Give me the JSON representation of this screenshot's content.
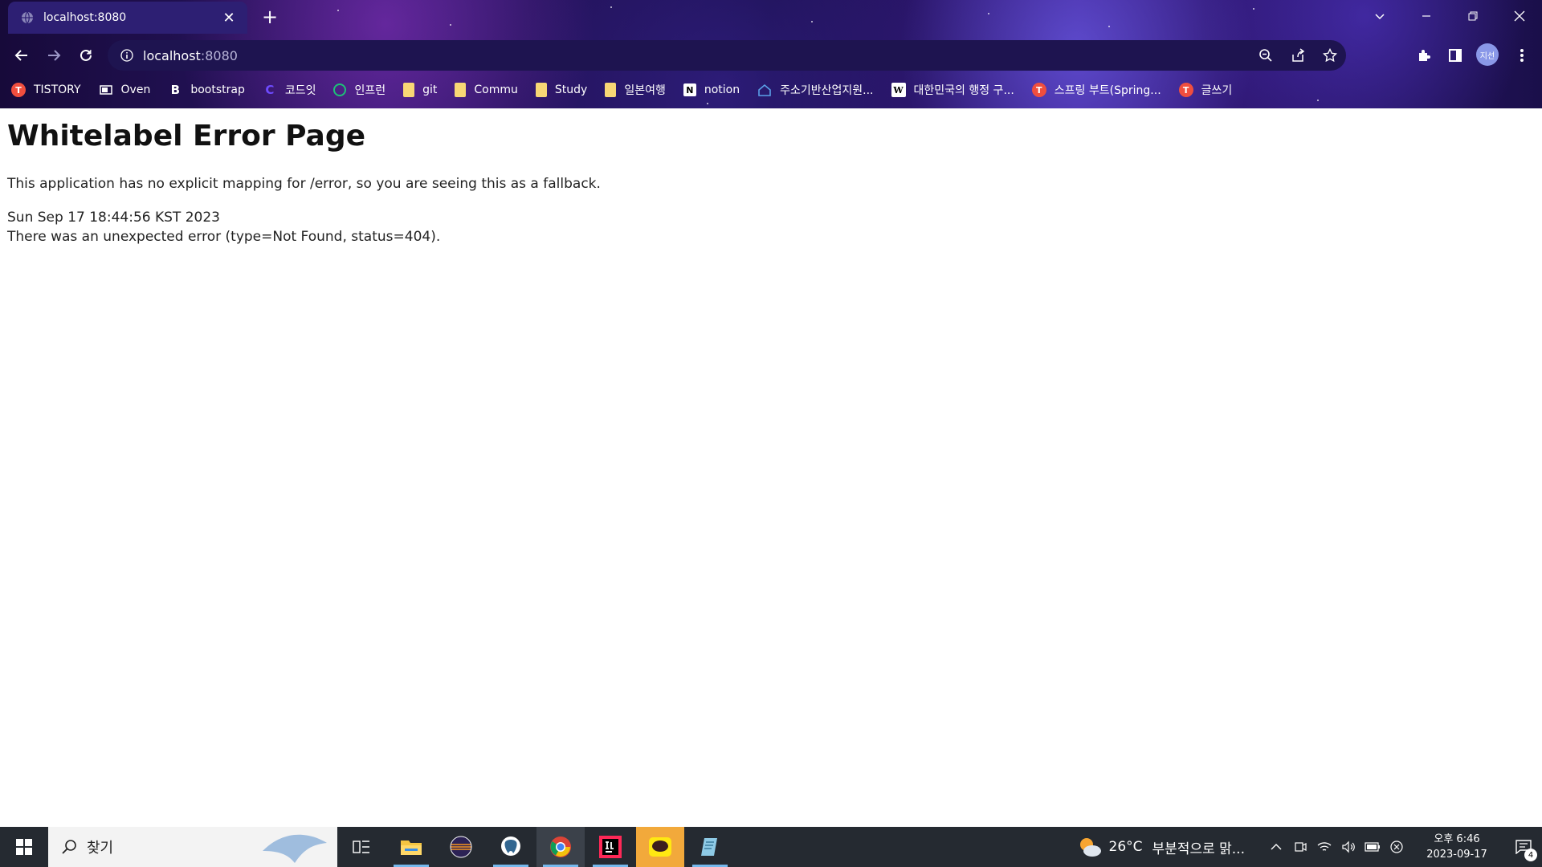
{
  "browser": {
    "tab": {
      "title": "localhost:8080",
      "close_glyph": "✕"
    },
    "new_tab_glyph": "+",
    "address": {
      "host": "localhost",
      "port": ":8080"
    },
    "profile_avatar": "지선",
    "bookmarks": [
      {
        "label": "TISTORY",
        "icon": "tistory-icon",
        "color": "#f04e3e"
      },
      {
        "label": "Oven",
        "icon": "oven-icon",
        "color": "#ffffff"
      },
      {
        "label": "bootstrap",
        "icon": "bootstrap-icon",
        "color": "#ffffff"
      },
      {
        "label": "코드잇",
        "icon": "codeit-icon",
        "color": "#6e4bff"
      },
      {
        "label": "인프런",
        "icon": "inflearn-icon",
        "color": "#1dc078"
      },
      {
        "label": "git",
        "icon": "folder-icon",
        "color": "#f8d775"
      },
      {
        "label": "Commu",
        "icon": "folder-icon",
        "color": "#f8d775"
      },
      {
        "label": "Study",
        "icon": "folder-icon",
        "color": "#f8d775"
      },
      {
        "label": "일본여행",
        "icon": "folder-icon",
        "color": "#f8d775"
      },
      {
        "label": "notion",
        "icon": "notion-icon",
        "color": "#ffffff"
      },
      {
        "label": "주소기반산업지원...",
        "icon": "juso-icon",
        "color": "#5aa0e8"
      },
      {
        "label": "대한민국의 행정 구...",
        "icon": "wikipedia-icon",
        "color": "#ffffff"
      },
      {
        "label": "스프링 부트(Spring...",
        "icon": "tistory-icon",
        "color": "#f04e3e"
      },
      {
        "label": "글쓰기",
        "icon": "tistory-icon",
        "color": "#f04e3e"
      }
    ]
  },
  "page": {
    "title": "Whitelabel Error Page",
    "message": "This application has no explicit mapping for /error, so you are seeing this as a fallback.",
    "timestamp": "Sun Sep 17 18:44:56 KST 2023",
    "error_detail": "There was an unexpected error (type=Not Found, status=404)."
  },
  "taskbar": {
    "search_placeholder": "찾기",
    "weather": {
      "temp": "26°C",
      "desc": "부분적으로 맑..."
    },
    "clock": {
      "time": "오후 6:46",
      "date": "2023-09-17"
    },
    "notification_count": "4",
    "apps": [
      "task-view-icon",
      "file-explorer-icon",
      "eclipse-icon",
      "postgresql-icon",
      "chrome-icon",
      "intellij-icon",
      "kakaotalk-icon",
      "notepad-icon"
    ]
  },
  "colors": {
    "accent": "#76b9ed",
    "taskbar_bg": "#252a31",
    "chrome_bg": "#2a1668"
  }
}
